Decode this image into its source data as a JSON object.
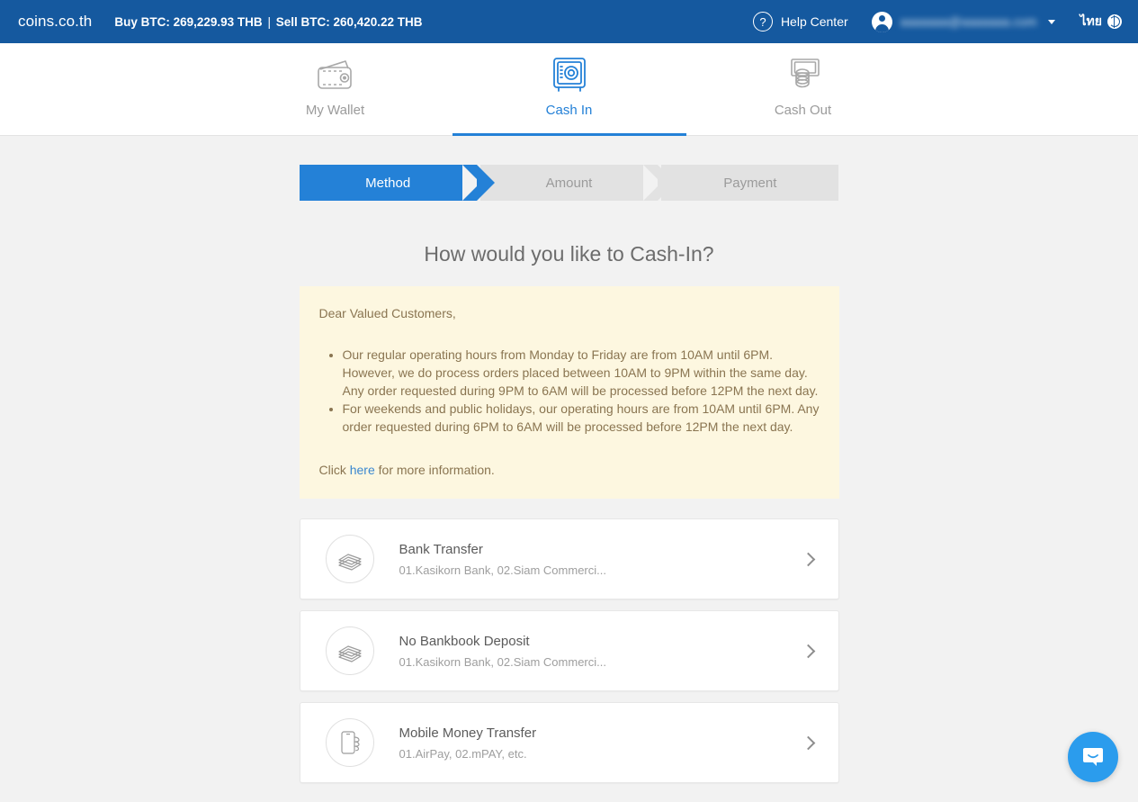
{
  "header": {
    "brand": "coins.co.th",
    "buy_rate": "Buy BTC: 269,229.93 THB",
    "separator": "|",
    "sell_rate": "Sell BTC: 260,420.22 THB",
    "help_center": "Help Center",
    "help_icon": "question-mark-circle-icon",
    "user_email": "aaaaaaa@aaaaaaa.com",
    "avatar_icon": "user-avatar-icon",
    "caret_icon": "chevron-down-icon",
    "language": "ไทย",
    "globe_icon": "globe-icon",
    "background_color": "#15599f"
  },
  "tabs": [
    {
      "label": "My Wallet",
      "icon": "wallet-icon",
      "active": false
    },
    {
      "label": "Cash In",
      "icon": "safe-vault-icon",
      "active": true
    },
    {
      "label": "Cash Out",
      "icon": "banknote-coins-icon",
      "active": false
    }
  ],
  "steps": [
    {
      "label": "Method",
      "state": "active"
    },
    {
      "label": "Amount",
      "state": "inactive"
    },
    {
      "label": "Payment",
      "state": "inactive"
    }
  ],
  "main": {
    "page_title": "How would you like to Cash-In?",
    "notice": {
      "greeting": "Dear Valued Customers,",
      "bullets": [
        "Our regular operating hours from Monday to Friday are from 10AM until 6PM. However, we do process orders placed between 10AM to 9PM within the same day. Any order requested during 9PM to 6AM will be processed before 12PM the next day.",
        "For weekends and public holidays, our operating hours are from 10AM until 6PM. Any order requested during 6PM to 6AM will be processed before 12PM the next day."
      ],
      "footer_before": "Click ",
      "footer_link": "here",
      "footer_after": " for more information.",
      "background_color": "#fdf7e0"
    },
    "methods": [
      {
        "title": "Bank Transfer",
        "subtitle": "01.Kasikorn Bank, 02.Siam Commerci...",
        "icon": "cash-stack-icon"
      },
      {
        "title": "No Bankbook Deposit",
        "subtitle": "01.Kasikorn Bank, 02.Siam Commerci...",
        "icon": "cash-stack-icon"
      },
      {
        "title": "Mobile Money Transfer",
        "subtitle": "01.AirPay, 02.mPAY, etc.",
        "icon": "mobile-phone-hand-icon"
      }
    ]
  },
  "chat": {
    "icon": "chat-bubble-icon",
    "color": "#2b9ced"
  },
  "colors": {
    "accent": "#2481d7",
    "header": "#15599f",
    "page_bg": "#f2f2f2",
    "notice_bg": "#fdf7e0",
    "link": "#3a87d0"
  }
}
